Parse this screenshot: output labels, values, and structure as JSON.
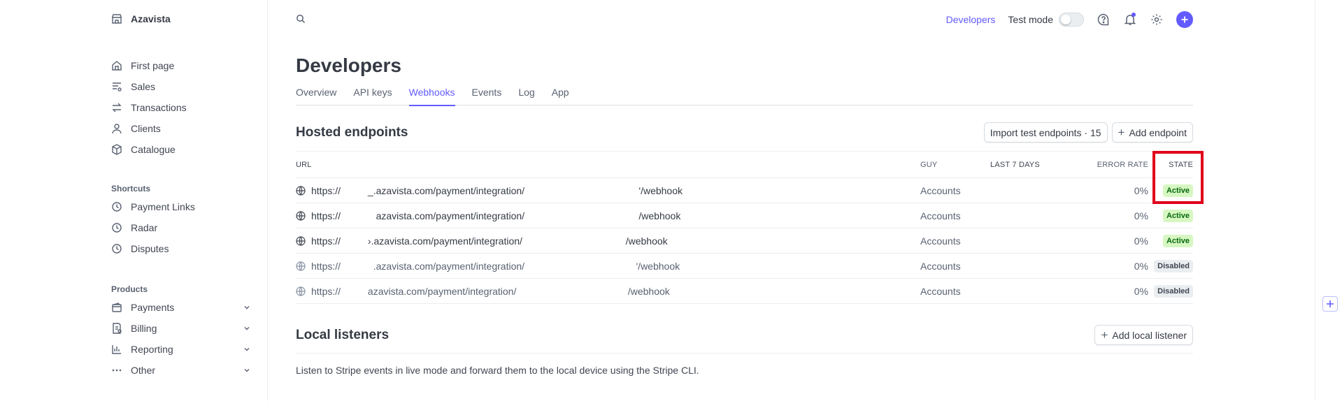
{
  "brand": {
    "name": "Azavista"
  },
  "sidebar": {
    "main": [
      {
        "label": "First page",
        "icon": "home-icon"
      },
      {
        "label": "Sales",
        "icon": "sales-icon"
      },
      {
        "label": "Transactions",
        "icon": "transactions-icon"
      },
      {
        "label": "Clients",
        "icon": "user-icon"
      },
      {
        "label": "Catalogue",
        "icon": "box-icon"
      }
    ],
    "shortcuts_title": "Shortcuts",
    "shortcuts": [
      {
        "label": "Payment Links",
        "icon": "clock-icon"
      },
      {
        "label": "Radar",
        "icon": "clock-icon"
      },
      {
        "label": "Disputes",
        "icon": "clock-icon"
      }
    ],
    "products_title": "Products",
    "products": [
      {
        "label": "Payments",
        "icon": "wallet-icon"
      },
      {
        "label": "Billing",
        "icon": "billing-icon"
      },
      {
        "label": "Reporting",
        "icon": "chart-icon"
      },
      {
        "label": "Other",
        "icon": "dots-icon"
      }
    ]
  },
  "topbar": {
    "developers": "Developers",
    "test_mode": "Test mode"
  },
  "page": {
    "title": "Developers",
    "tabs": [
      "Overview",
      "API keys",
      "Webhooks",
      "Events",
      "Log",
      "App"
    ],
    "active_tab": "Webhooks"
  },
  "hosted": {
    "title": "Hosted endpoints",
    "import_button": "Import test endpoints · 15",
    "add_button": "Add endpoint",
    "columns": {
      "url": "URL",
      "guy": "GUY",
      "last7": "LAST 7 DAYS",
      "error_rate": "ERROR RATE",
      "state": "STATE"
    },
    "rows": [
      {
        "url": "https://          _.azavista.com/payment/integration/                                          '/webhook",
        "guy": "Accounts",
        "error_rate": "0%",
        "state": "Active"
      },
      {
        "url": "https://             azavista.com/payment/integration/                                          /webhook",
        "guy": "Accounts",
        "error_rate": "0%",
        "state": "Active"
      },
      {
        "url": "https://          ›.azavista.com/payment/integration/                                      /webhook",
        "guy": "Accounts",
        "error_rate": "0%",
        "state": "Active"
      },
      {
        "url": "https://            .azavista.com/payment/integration/                                         '/webhook",
        "guy": "Accounts",
        "error_rate": "0%",
        "state": "Disabled"
      },
      {
        "url": "https://          azavista.com/payment/integration/                                         /webhook",
        "guy": "Accounts",
        "error_rate": "0%",
        "state": "Disabled"
      }
    ]
  },
  "local": {
    "title": "Local listeners",
    "add_button": "Add local listener",
    "description": "Listen to Stripe events in live mode and forward them to the local device using the Stripe CLI."
  },
  "colors": {
    "accent": "#635bff",
    "active_bg": "#d7f7c2",
    "active_text": "#05690d",
    "highlight": "#e0001b"
  }
}
